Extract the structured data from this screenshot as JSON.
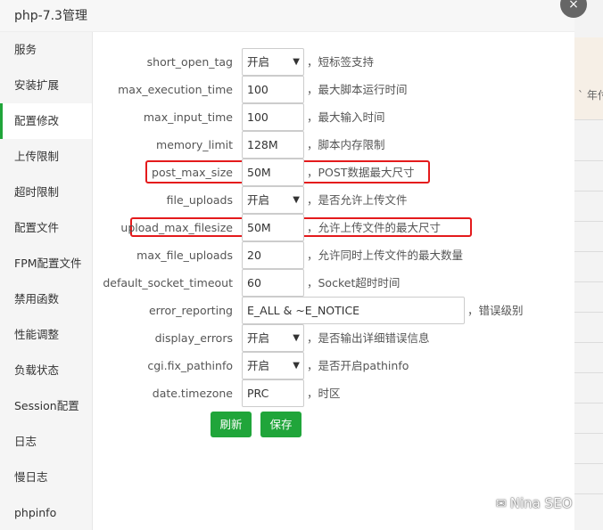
{
  "background_page": {
    "snippet": "` 年付"
  },
  "dialog": {
    "title": "php-7.3管理",
    "close_glyph": "×"
  },
  "sidebar": {
    "items": [
      {
        "label": "服务"
      },
      {
        "label": "安装扩展"
      },
      {
        "label": "配置修改",
        "active": true
      },
      {
        "label": "上传限制"
      },
      {
        "label": "超时限制"
      },
      {
        "label": "配置文件"
      },
      {
        "label": "FPM配置文件"
      },
      {
        "label": "禁用函数"
      },
      {
        "label": "性能调整"
      },
      {
        "label": "负载状态"
      },
      {
        "label": "Session配置"
      },
      {
        "label": "日志"
      },
      {
        "label": "慢日志"
      },
      {
        "label": "phpinfo"
      }
    ]
  },
  "settings": [
    {
      "name": "short_open_tag",
      "type": "select",
      "value": "开启",
      "desc": "，短标签支持"
    },
    {
      "name": "max_execution_time",
      "type": "input",
      "value": "100",
      "desc": "，最大脚本运行时间"
    },
    {
      "name": "max_input_time",
      "type": "input",
      "value": "100",
      "desc": "，最大输入时间"
    },
    {
      "name": "memory_limit",
      "type": "input",
      "value": "128M",
      "desc": "，脚本内存限制"
    },
    {
      "name": "post_max_size",
      "type": "input",
      "value": "50M",
      "desc": "，POST数据最大尺寸"
    },
    {
      "name": "file_uploads",
      "type": "select",
      "value": "开启",
      "desc": "，是否允许上传文件"
    },
    {
      "name": "upload_max_filesize",
      "type": "input",
      "value": "50M",
      "desc": "，允许上传文件的最大尺寸"
    },
    {
      "name": "max_file_uploads",
      "type": "input",
      "value": "20",
      "desc": "，允许同时上传文件的最大数量"
    },
    {
      "name": "default_socket_timeout",
      "type": "input",
      "value": "60",
      "desc": "，Socket超时时间"
    },
    {
      "name": "error_reporting",
      "type": "input-wide",
      "value": "E_ALL & ~E_NOTICE",
      "desc": "，错误级别"
    },
    {
      "name": "display_errors",
      "type": "select",
      "value": "开启",
      "desc": "，是否输出详细错误信息"
    },
    {
      "name": "cgi.fix_pathinfo",
      "type": "select",
      "value": "开启",
      "desc": "，是否开启pathinfo"
    },
    {
      "name": "date.timezone",
      "type": "input",
      "value": "PRC",
      "desc": "，时区"
    }
  ],
  "buttons": {
    "refresh": "刷新",
    "save": "保存"
  },
  "watermark": {
    "text": "Nina SEO"
  },
  "colors": {
    "accent": "#20a53a",
    "highlight": "#e41a1c"
  }
}
